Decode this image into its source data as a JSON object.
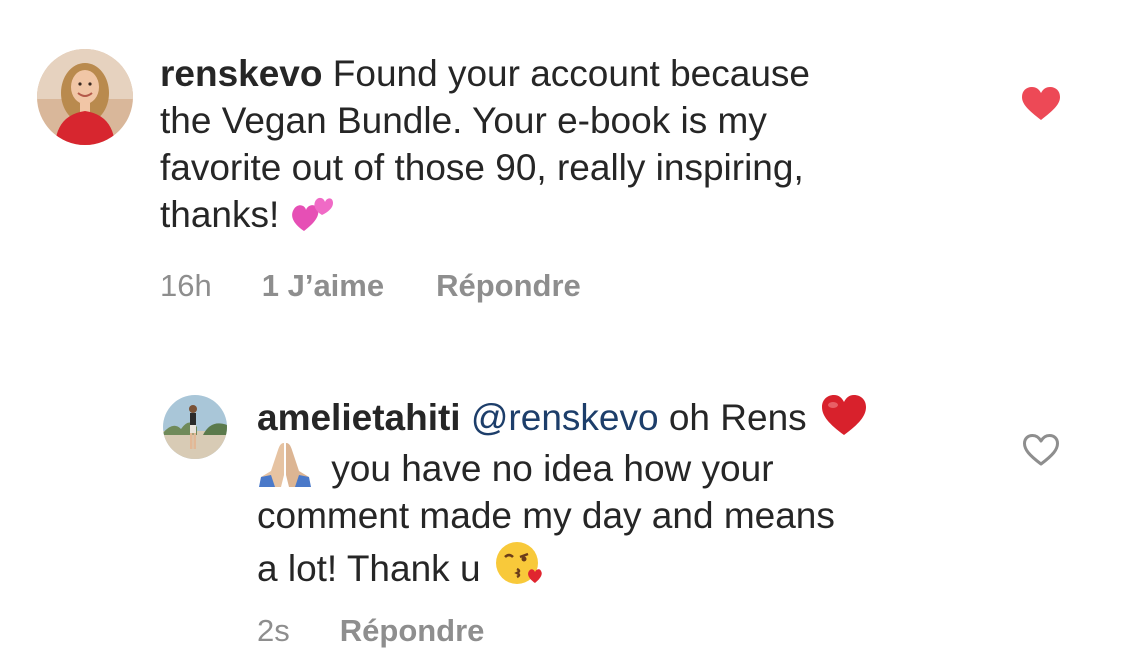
{
  "comments": [
    {
      "username": "renskevo",
      "mention": "",
      "text_lines": [
        "Found your account because",
        "the Vegan Bundle. Your e-book is my",
        "favorite out of those 90, really inspiring,",
        "thanks!"
      ],
      "emoji": "two-hearts",
      "time": "16h",
      "likes_label": "1 J’aime",
      "reply_label": "Répondre",
      "liked": true,
      "avatar_icon": "avatar-woman-red-top"
    },
    {
      "username": "amelietahiti",
      "mention": "@renskevo",
      "text_line1_after_mention": "oh Rens",
      "text_line2": "you have no idea how your",
      "text_line3": "comment made my day and means",
      "text_line4": "a lot! Thank u",
      "emojis": [
        "red-heart",
        "folded-hands",
        "face-blowing-kiss"
      ],
      "time": "2s",
      "reply_label": "Répondre",
      "liked": false,
      "avatar_icon": "avatar-woman-beach"
    }
  ],
  "colors": {
    "text": "#262626",
    "meta": "#8e8e8e",
    "mention": "#1d3e6a",
    "like_active": "#ed4956",
    "like_inactive": "#8e8e8e"
  }
}
